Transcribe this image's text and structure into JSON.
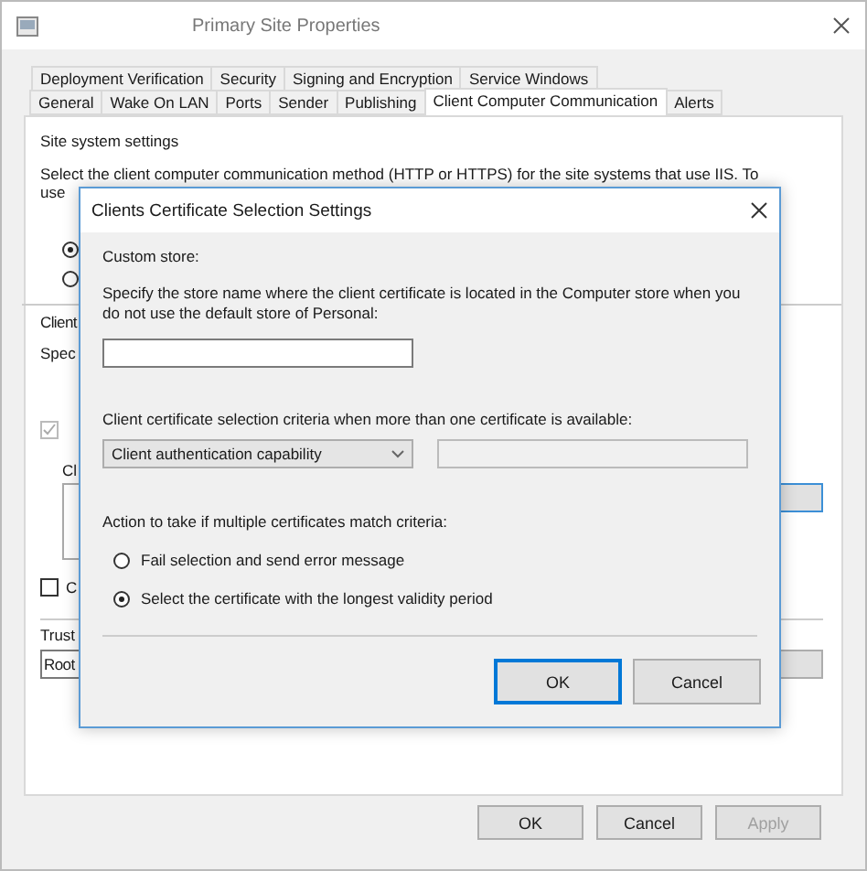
{
  "window": {
    "title": "Primary Site Properties"
  },
  "tab_rows": [
    [
      {
        "label": "Deployment Verification",
        "selected": false
      },
      {
        "label": "Security",
        "selected": false
      },
      {
        "label": "Signing and Encryption",
        "selected": false
      },
      {
        "label": "Service Windows",
        "selected": false
      }
    ],
    [
      {
        "label": "General",
        "selected": false
      },
      {
        "label": "Wake On LAN",
        "selected": false
      },
      {
        "label": "Ports",
        "selected": false
      },
      {
        "label": "Sender",
        "selected": false
      },
      {
        "label": "Publishing",
        "selected": false
      },
      {
        "label": "Client Computer Communication",
        "selected": true
      },
      {
        "label": "Alerts",
        "selected": false
      }
    ]
  ],
  "panel": {
    "heading": "Site system settings",
    "description": "Select the client computer communication method (HTTP or HTTPS) for the site systems that use IIS. To",
    "description_cut": "use",
    "radios": [
      {
        "selected": true
      },
      {
        "selected": false
      }
    ],
    "section_label": "Client",
    "section_text": "Spec",
    "use_checkbox": {
      "checked": true,
      "disabled": true
    },
    "list_label": "Cl",
    "other_checkbox": {
      "label": "C",
      "checked": false,
      "disabled": false
    },
    "trust_label": "Trust",
    "trust_value": "Root"
  },
  "buttons": [
    {
      "label": "OK",
      "disabled": false
    },
    {
      "label": "Cancel",
      "disabled": false
    },
    {
      "label": "Apply",
      "disabled": true
    }
  ],
  "dialog": {
    "title": "Clients Certificate Selection Settings",
    "custom_store_label": "Custom store:",
    "store_description": "Specify the store name where the client certificate is located in the Computer store when you do not use the default store of Personal:",
    "criteria_label": "Client certificate selection criteria when more than one certificate is available:",
    "criteria_value": "Client authentication capability",
    "action_label": "Action to take if multiple certificates match criteria:",
    "actions": [
      {
        "label": "Fail selection and send error message",
        "selected": false
      },
      {
        "label": "Select the certificate with the longest validity period",
        "selected": true
      }
    ],
    "buttons": [
      {
        "label": "OK",
        "default": true
      },
      {
        "label": "Cancel",
        "default": false
      }
    ]
  }
}
